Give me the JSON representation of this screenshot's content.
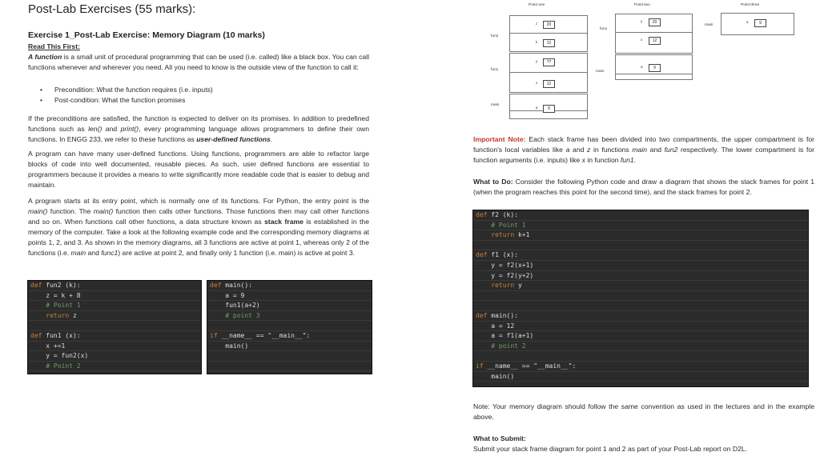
{
  "left": {
    "title": "Post-Lab Exercises (55 marks):",
    "exercise_title": "Exercise 1_Post-Lab Exercise: Memory Diagram (10 marks)",
    "read_first": "Read This First:",
    "p1_italic": "A function",
    "p1_rest": " is a small unit of procedural programming that can be used (i.e. called) like a black box. You can call functions whenever and wherever you need. All you need to know is the outside view of the function to call it:",
    "bullets": [
      "Precondition: What the function requires (i.e. inputs)",
      "Post-condition: What the function promises"
    ],
    "p2_a": "If the preconditions are satisfied, the function is expected to deliver on its promises. In addition to predefined functions such as ",
    "p2_len": "len()",
    "p2_and": " and ",
    "p2_print": "print()",
    "p2_b": ", every programming language allows programmers to define their own functions. In ENGG 233, we refer to these functions as ",
    "p2_bold": "user-defined functions",
    "p2_end": ".",
    "p3": "A program can have many user-defined functions. Using functions, programmers are able to refactor large blocks of code into well documented, reusable pieces. As such, user defined functions are essential to programmers because it provides a means to write significantly more readable code that is easier to debug and maintain.",
    "p4_a": "A program starts at its entry point, which is normally one of its functions. For Python, the entry point is the ",
    "p4_main": "main()",
    "p4_b": " function. The ",
    "p4_main2": "main()",
    "p4_c": " function then calls other functions. Those functions then may call other functions and so on. When functions call other functions, a data structure known as ",
    "p4_bold": "stack frame",
    "p4_d": " is established in the memory of the computer. Take a look at the following example code and the corresponding memory diagrams at points 1, 2, and 3. As shown in the memory diagrams, all 3 functions are active at point 1, whereas only 2 of the functions (i.e. ",
    "p4_it1": "main",
    "p4_e": " and ",
    "p4_it2": "func1",
    "p4_f": ") are active at point 2, and finally only 1 function (i.e. main) is active at point 3.",
    "code_a": [
      {
        "k": "def ",
        "t": "fun2 (k):",
        "c": ""
      },
      {
        "k": "",
        "t": "    z = k + 8",
        "c": ""
      },
      {
        "k": "",
        "t": "",
        "c": "    # Point 1"
      },
      {
        "k": "    return ",
        "t": "z",
        "c": ""
      },
      {
        "k": "",
        "t": "",
        "c": ""
      },
      {
        "k": "def ",
        "t": "fun1 (x):",
        "c": ""
      },
      {
        "k": "",
        "t": "    x +=1",
        "c": ""
      },
      {
        "k": "",
        "t": "    y = fun2(x)",
        "c": ""
      },
      {
        "k": "",
        "t": "",
        "c": "    # Point 2"
      }
    ],
    "code_b": [
      {
        "k": "def ",
        "t": "main():",
        "c": ""
      },
      {
        "k": "",
        "t": "    a = 9",
        "c": ""
      },
      {
        "k": "",
        "t": "    fun1(a+2)",
        "c": ""
      },
      {
        "k": "",
        "t": "",
        "c": "    # point 3"
      },
      {
        "k": "",
        "t": "",
        "c": ""
      },
      {
        "k": "if ",
        "t": "__name__ == \"__main__\":",
        "c": ""
      },
      {
        "k": "",
        "t": "    main()",
        "c": ""
      },
      {
        "k": "",
        "t": "",
        "c": ""
      },
      {
        "k": "",
        "t": "",
        "c": ""
      }
    ]
  },
  "diagram": {
    "point_one": "Point one",
    "point_two": "Point two",
    "point_three": "Point three",
    "p1_fun2": "fun2",
    "p1_fun1": "fun1",
    "p1_main": "main",
    "p1_z_name": "z",
    "p1_z_val": "20",
    "p1_k_name": "k",
    "p1_k_val": "12",
    "p1_y_name": "y",
    "p1_y_val": "??",
    "p1_x_name": "x",
    "p1_x_val": "12",
    "p1_a_name": "a",
    "p1_a_val": "9",
    "p2_fun1": "fun1",
    "p2_main": "main",
    "p2_y_name": "y",
    "p2_y_val": "20",
    "p2_x_name": "x",
    "p2_x_val": "12",
    "p2_a_name": "a",
    "p2_a_val": "9",
    "p3_main": "main",
    "p3_a_name": "a",
    "p3_a_val": "9"
  },
  "right": {
    "note_bold": "Important Note:",
    "note_a": " Each stack frame has been divided into two compartments, the upper compartment is for function's local variables like ",
    "note_a_var": "a",
    "note_b": " and ",
    "note_z_var": "z",
    "note_c": " in functions ",
    "note_main": "main",
    "note_d": " and ",
    "note_fun2": "fun2",
    "note_e": " respectively. The lower compartment is for function arguments (i.e. inputs) like ",
    "note_x": "x",
    "note_f": " in function ",
    "note_fun1": "fun1",
    "note_g": ".",
    "todo_bold": "What to Do:",
    "todo_rest": " Consider the following Python code and draw a diagram that shows the stack frames for point 1 (when the program reaches this point for the second time), and the stack frames for point 2.",
    "code": [
      {
        "k": "def ",
        "t": "f2 (k):",
        "c": ""
      },
      {
        "k": "",
        "t": "",
        "c": "    # Point 1"
      },
      {
        "k": "    return ",
        "t": "k+1",
        "c": ""
      },
      {
        "k": "",
        "t": "",
        "c": ""
      },
      {
        "k": "def ",
        "t": "f1 (x):",
        "c": ""
      },
      {
        "k": "",
        "t": "    y = f2(x+1)",
        "c": ""
      },
      {
        "k": "",
        "t": "    y = f2(y+2)",
        "c": ""
      },
      {
        "k": "    return ",
        "t": "y",
        "c": ""
      },
      {
        "k": "",
        "t": "",
        "c": ""
      },
      {
        "k": "",
        "t": "",
        "c": ""
      },
      {
        "k": "def ",
        "t": "main():",
        "c": ""
      },
      {
        "k": "",
        "t": "    a = 12",
        "c": ""
      },
      {
        "k": "",
        "t": "    a = f1(a+1)",
        "c": ""
      },
      {
        "k": "",
        "t": "",
        "c": "    # point 2"
      },
      {
        "k": "",
        "t": "",
        "c": ""
      },
      {
        "k": "if ",
        "t": "__name__ == \"__main__\":",
        "c": ""
      },
      {
        "k": "",
        "t": "    main()",
        "c": ""
      }
    ],
    "final_note": "Note: Your memory diagram should follow the same convention as used in the lectures and in the example above.",
    "submit_title": "What to Submit:",
    "submit_text": "Submit your stack frame diagram for point 1 and 2 as part of your Post-Lab report on D2L."
  }
}
